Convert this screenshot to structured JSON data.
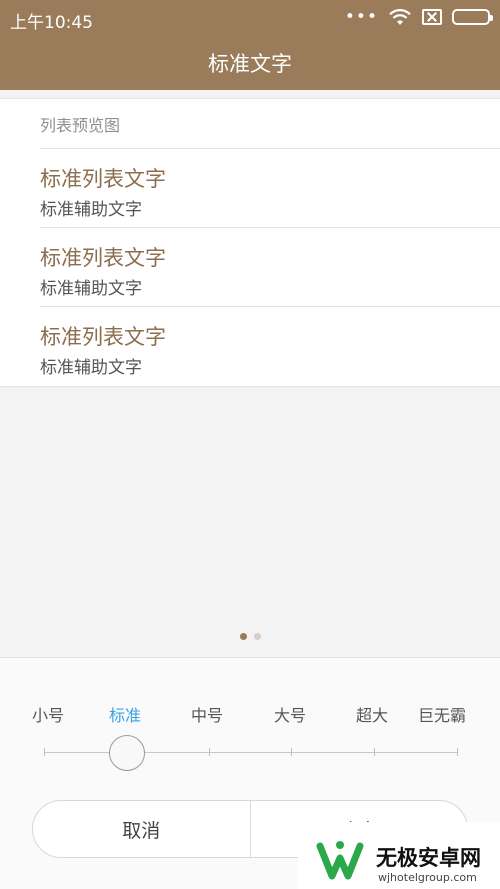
{
  "status_bar": {
    "time": "上午10:45",
    "icons": [
      "dots-icon",
      "wifi-icon",
      "sim-disabled-icon",
      "battery-icon"
    ],
    "dots": "•••"
  },
  "title_bar": {
    "title": "标准文字"
  },
  "preview": {
    "header": "列表预览图",
    "items": [
      {
        "title": "标准列表文字",
        "subtitle": "标准辅助文字"
      },
      {
        "title": "标准列表文字",
        "subtitle": "标准辅助文字"
      },
      {
        "title": "标准列表文字",
        "subtitle": "标准辅助文字"
      }
    ]
  },
  "pager": {
    "count": 2,
    "active_index": 0,
    "active_color": "#9a7c5a",
    "inactive_color": "#d9cfc4"
  },
  "font_size_picker": {
    "options": [
      "小号",
      "标准",
      "中号",
      "大号",
      "超大",
      "巨无霸"
    ],
    "selected_index": 1,
    "selected_color": "#3aa4e8"
  },
  "actions": {
    "cancel_label": "取消",
    "confirm_label": "确定"
  },
  "watermark": {
    "name": "无极安卓网",
    "url": "wjhotelgroup.com"
  },
  "colors": {
    "header_bg": "#9a7c5a",
    "title_text": "#8c6e4e",
    "logo_green": "#2aa84a"
  }
}
